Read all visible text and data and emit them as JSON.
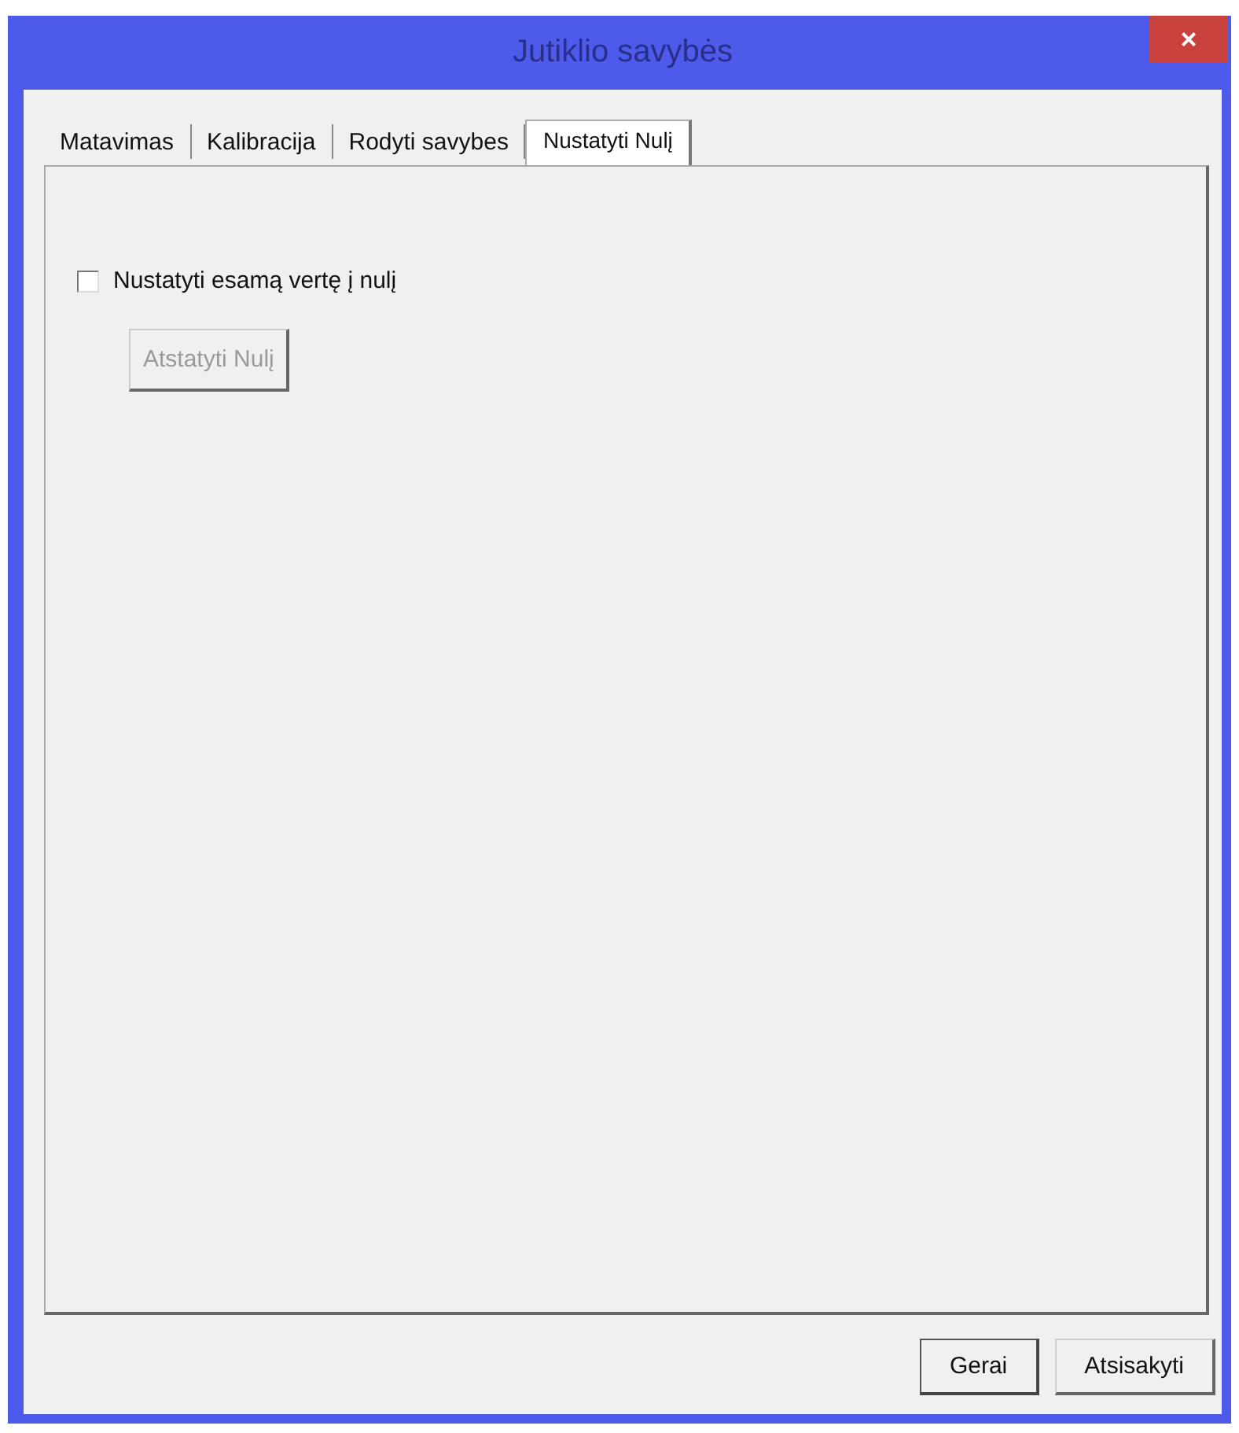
{
  "window": {
    "title": "Jutiklio savybės",
    "close_glyph": "×"
  },
  "tabs": [
    {
      "label": "Matavimas",
      "selected": false
    },
    {
      "label": "Kalibracija",
      "selected": false
    },
    {
      "label": "Rodyti savybes",
      "selected": false
    },
    {
      "label": "Nustatyti Nulį",
      "selected": true
    }
  ],
  "panel": {
    "checkbox": {
      "label": "Nustatyti esamą vertę į nulį",
      "checked": false
    },
    "reset_button": {
      "label": "Atstatyti Nulį",
      "disabled": true
    }
  },
  "buttons": [
    "Gerai",
    "Atsisakyti"
  ]
}
